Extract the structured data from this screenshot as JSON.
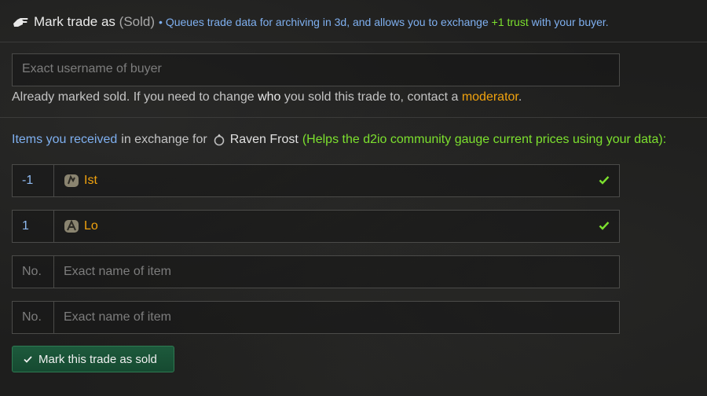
{
  "header": {
    "title": "Mark trade as",
    "status": "(Sold)",
    "bullet": "•",
    "desc_prefix": "Queues trade data for archiving in 3d, and allows you to exchange",
    "trust": "+1 trust",
    "desc_suffix": "with your buyer.",
    "icon": "hand-pointing-icon"
  },
  "buyer": {
    "placeholder": "Exact username of buyer"
  },
  "note": {
    "prefix": "Already marked sold. If you need to change",
    "who": "who",
    "middle": "you sold this trade to, contact a",
    "link": "moderator",
    "suffix": "."
  },
  "received": {
    "blue": "Items you received",
    "middle": "in exchange for",
    "item": "Raven Frost",
    "note": "(Helps the d2io community gauge current prices using your data):"
  },
  "items": [
    {
      "qty": "-1",
      "name": "Ist",
      "icon": "rune-icon",
      "checked": true
    },
    {
      "qty": "1",
      "name": "Lo",
      "icon": "rune-icon",
      "checked": true
    }
  ],
  "empty_rows": [
    {
      "qty_placeholder": "No.",
      "name_placeholder": "Exact name of item"
    },
    {
      "qty_placeholder": "No.",
      "name_placeholder": "Exact name of item"
    }
  ],
  "submit": {
    "label": "Mark this trade as sold"
  },
  "colors": {
    "accent_blue": "#7fb0f0",
    "trust_green": "#7ce02e",
    "rune_orange": "#f0a20e",
    "button_green": "#1d5a3c"
  }
}
